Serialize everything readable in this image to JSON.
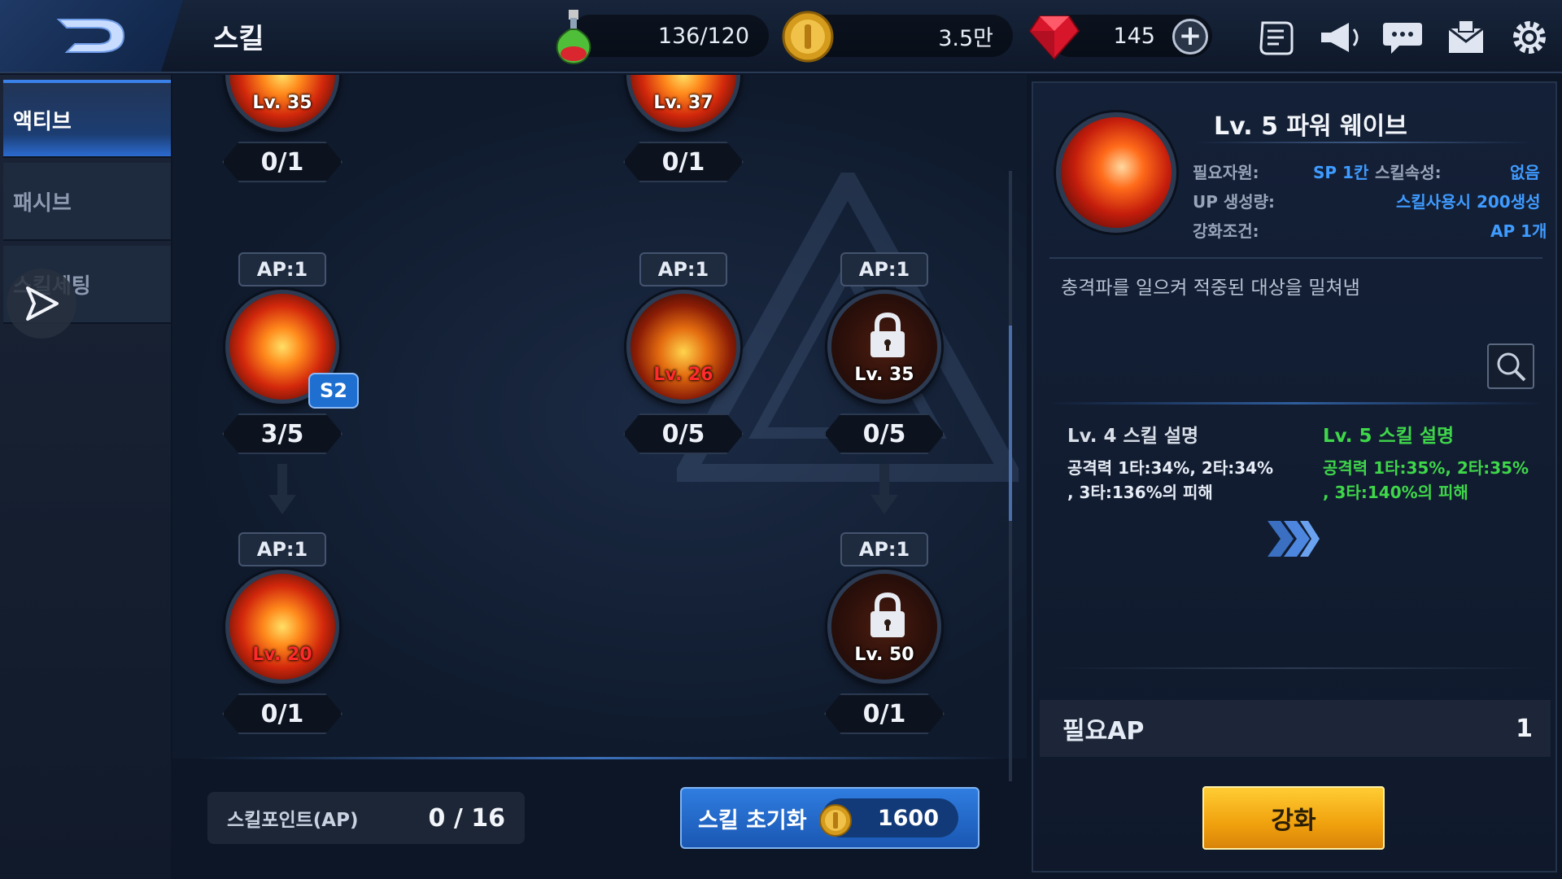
{
  "header": {
    "title": "스킬",
    "stamina": "136/120",
    "gold": "3.5만",
    "gems": "145"
  },
  "sidebar": {
    "tabs": [
      {
        "label": "액티브",
        "active": true
      },
      {
        "label": "패시브",
        "active": false
      },
      {
        "label": "스킬세팅",
        "active": false
      }
    ]
  },
  "tree": {
    "nodes": [
      {
        "id": "n1",
        "ap": "",
        "level_label": "Lv. 35",
        "count": "0/1"
      },
      {
        "id": "n2",
        "ap": "",
        "level_label": "Lv. 37",
        "count": "0/1"
      },
      {
        "id": "n3",
        "ap": "AP:1",
        "level_label": "",
        "count": "3/5",
        "slot": "S2"
      },
      {
        "id": "n4",
        "ap": "AP:1",
        "level_label": "Lv. 26",
        "count": "0/5"
      },
      {
        "id": "n5",
        "ap": "AP:1",
        "level_label": "Lv. 35",
        "count": "0/5",
        "locked": true
      },
      {
        "id": "n6",
        "ap": "AP:1",
        "level_label": "Lv. 20",
        "count": "0/1"
      },
      {
        "id": "n7",
        "ap": "AP:1",
        "level_label": "Lv. 50",
        "count": "0/1",
        "locked": true
      }
    ]
  },
  "footer": {
    "ap_label": "스킬포인트(AP)",
    "ap_value": "0 / 16",
    "reset_label": "스킬 초기화",
    "reset_cost": "1600"
  },
  "detail": {
    "title": "Lv. 5 파워 웨이브",
    "req_resource_label": "필요자원:",
    "req_resource_value": "SP 1칸",
    "attribute_label": "스킬속성:",
    "attribute_value": "없음",
    "up_label": "UP 생성량:",
    "up_value": "스킬사용시 200생성",
    "cond_label": "강화조건:",
    "cond_value": "AP 1개",
    "description": "충격파를 일으켜 적중된 대상을  밀쳐냄",
    "current_head": "Lv. 4 스킬 설명",
    "current_body_1": "공격력 1타:34%, 2타:34%",
    "current_body_2": ", 3타:136%의 피해",
    "next_head": "Lv. 5 스킬 설명",
    "next_body_1": "공격력 1타:35%, 2타:35%",
    "next_body_2": ", 3타:140%의 피해",
    "need_ap_label": "필요AP",
    "need_ap_value": "1",
    "upgrade_label": "강화"
  },
  "colors": {
    "accent_blue": "#3f9bff",
    "next_green": "#3fd64a",
    "button_gold": "#f0a10d",
    "locked_red": "#ff2a2a"
  },
  "icons": [
    "logo-icon",
    "potion-icon",
    "coin-icon",
    "ruby-icon",
    "plus-icon",
    "quest-scroll-icon",
    "megaphone-icon",
    "chat-icon",
    "mail-icon",
    "gear-icon",
    "play-icon",
    "lock-icon",
    "magnifier-icon",
    "chevron-right-icon"
  ]
}
